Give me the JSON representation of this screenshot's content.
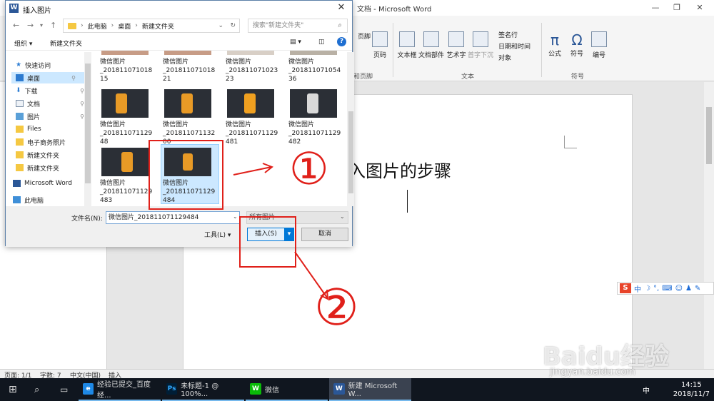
{
  "word": {
    "title": "文档 - Microsoft Word",
    "ribbon": {
      "items": [
        "页脚",
        "页码",
        "文本框",
        "文档部件",
        "艺术字",
        "首字下沉",
        "公式",
        "符号",
        "编号"
      ],
      "small": [
        "签名行",
        "日期和时间",
        "对象"
      ],
      "groups": [
        "和页脚",
        "文本",
        "符号"
      ]
    },
    "doc_heading": "入图片的步骤"
  },
  "dialog": {
    "title": "插入图片",
    "breadcrumb": [
      "此电脑",
      "桌面",
      "新建文件夹"
    ],
    "search_placeholder": "搜索\"新建文件夹\"",
    "organize": "组织",
    "new_folder": "新建文件夹",
    "sidebar": [
      {
        "label": "快速访问",
        "icon": "star-icon"
      },
      {
        "label": "桌面",
        "icon": "desktop-icon",
        "pinned": true,
        "selected": true
      },
      {
        "label": "下载",
        "icon": "download-icon",
        "pinned": true
      },
      {
        "label": "文档",
        "icon": "document-icon",
        "pinned": true
      },
      {
        "label": "图片",
        "icon": "pictures-icon",
        "pinned": true
      },
      {
        "label": "Files",
        "icon": "folder-icon"
      },
      {
        "label": "电子商务照片",
        "icon": "folder-icon"
      },
      {
        "label": "新建文件夹",
        "icon": "folder-icon"
      },
      {
        "label": "新建文件夹",
        "icon": "folder-icon"
      },
      {
        "label": "Microsoft Word",
        "icon": "word-icon"
      },
      {
        "label": "此电脑",
        "icon": "computer-icon"
      }
    ],
    "files": [
      {
        "line1": "微信图片",
        "line2": "_201811071018",
        "line3": "15"
      },
      {
        "line1": "微信图片",
        "line2": "_201811071018",
        "line3": "21"
      },
      {
        "line1": "微信图片",
        "line2": "_201811071023",
        "line3": "23"
      },
      {
        "line1": "微信图片",
        "line2": "_201811071054",
        "line3": "36"
      },
      {
        "line1": "微信图片",
        "line2": "_201811071129",
        "line3": "48"
      },
      {
        "line1": "微信图片",
        "line2": "_201811071132",
        "line3": "00"
      },
      {
        "line1": "微信图片",
        "line2": "_201811071129",
        "line3": "481"
      },
      {
        "line1": "微信图片",
        "line2": "_201811071129",
        "line3": "482"
      },
      {
        "line1": "微信图片",
        "line2": "_201811071129",
        "line3": "483"
      },
      {
        "line1": "微信图片",
        "line2": "_201811071129",
        "line3": "484"
      }
    ],
    "filename_label": "文件名(N):",
    "filename_value": "微信图片_201811071129484",
    "filetype_value": "所有图片",
    "tools_label": "工具(L)",
    "insert_label": "插入(S)",
    "cancel_label": "取消"
  },
  "status": {
    "page": "页面: 1/1",
    "words": "字数: 7",
    "lang": "中文(中国)",
    "mode": "插入"
  },
  "taskbar": {
    "items": [
      "经验已提交_百度经...",
      "未标题-1 @ 100%...",
      "微信",
      "新建 Microsoft W..."
    ],
    "time": "14:15",
    "date": "2018/11/7",
    "ime": "中"
  },
  "annotations": {
    "mark1": "①",
    "mark2": "②"
  },
  "watermark": {
    "text": "Baidu经验",
    "url": "jingyan.baidu.com"
  }
}
